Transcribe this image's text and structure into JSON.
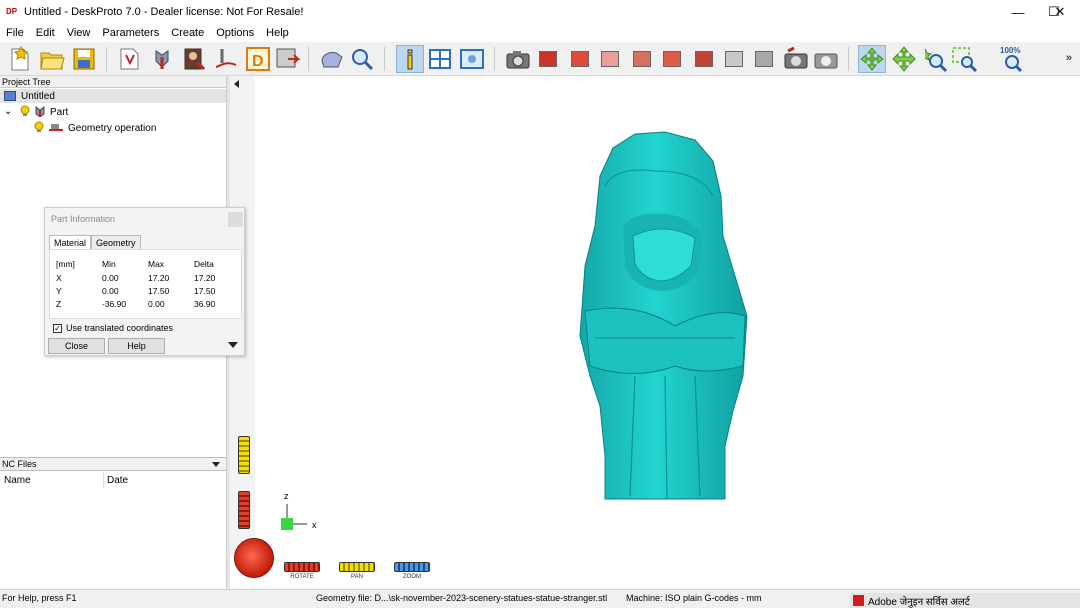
{
  "window": {
    "title": "Untitled - DeskProto 7.0 - Dealer license: Not For Resale!",
    "app_icon": "DP",
    "minimize_glyph": "—",
    "maximize_glyph": "☐",
    "close_glyph": "✕"
  },
  "menu": [
    "File",
    "Edit",
    "View",
    "Parameters",
    "Create",
    "Options",
    "Help"
  ],
  "toolbar": {
    "zoom_100_label": "100%",
    "more_glyph": "»",
    "accent_color": "#bcd8f0"
  },
  "project_tree": {
    "header": "Project Tree",
    "root": "Untitled",
    "part": "Part",
    "operation": "Geometry operation",
    "expand_glyph": "⌄"
  },
  "nc_files": {
    "header": "NC Files",
    "columns": [
      "Name",
      "Date"
    ]
  },
  "part_info_dialog": {
    "title": "Part Information",
    "tabs": [
      "Material",
      "Geometry"
    ],
    "columns": [
      "[mm]",
      "Min",
      "Max",
      "Delta"
    ],
    "rows": [
      {
        "axis": "X",
        "min": "0.00",
        "max": "17.20",
        "delta": "17.20"
      },
      {
        "axis": "Y",
        "min": "0.00",
        "max": "17.50",
        "delta": "17.50"
      },
      {
        "axis": "Z",
        "min": "-36.90",
        "max": "0.00",
        "delta": "36.90"
      }
    ],
    "checkbox_label": "Use translated coordinates",
    "checkbox_checked": true,
    "close_label": "Close",
    "help_label": "Help"
  },
  "viewport": {
    "model_color": "#1ec8c8",
    "axis_z": "z",
    "axis_x": "x",
    "controls": [
      "ROTATE",
      "PAN",
      "ZOOM"
    ]
  },
  "statusbar": {
    "help": "For Help, press F1",
    "geometry": "Geometry file: D...\\sk-november-2023-scenery-statues-statue-stranger.stl",
    "machine": "Machine: ISO plain G-codes - mm",
    "notification": "Adobe जेनुइन सर्विस अलर्ट"
  }
}
